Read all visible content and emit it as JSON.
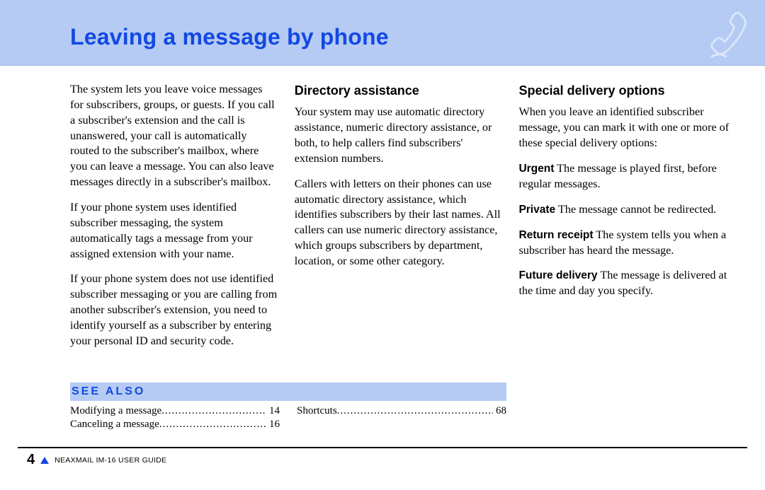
{
  "header": {
    "title": "Leaving a message by phone"
  },
  "col1": {
    "p1": "The system lets you leave voice messages for subscribers, groups, or guests. If you call a subscriber's extension and the call is unanswered, your call is automatically routed to the subscriber's mailbox, where you can leave a message. You can also leave messages directly in a subscriber's mailbox.",
    "p2": "If your phone system uses identified subscriber messaging, the system automatically tags a message from your assigned extension with your name.",
    "p3": "If your phone system does not use identified subscriber messaging or you are calling from another subscriber's extension, you need to identify yourself as a subscriber by entering your personal ID and security code."
  },
  "col2": {
    "heading": "Directory assistance",
    "p1": "Your system may use automatic directory assistance, numeric directory assistance, or both, to help callers find subscribers' extension numbers.",
    "p2": "Callers with letters on their phones can use automatic directory assistance, which identifies subscribers by their last names. All callers can use numeric directory assistance, which groups subscribers by department, location, or some other category."
  },
  "col3": {
    "heading": "Special delivery options",
    "intro": "When you leave an identified subscriber message, you can mark it with one or more of these special delivery options:",
    "opt1_label": "Urgent",
    "opt1_text": "  The message is played first, before regular messages.",
    "opt2_label": "Private",
    "opt2_text": "  The message cannot be redirected.",
    "opt3_label": "Return receipt",
    "opt3_text": "  The system tells you when a subscriber has heard the message.",
    "opt4_label": "Future delivery",
    "opt4_text": "  The message is delivered at the time and day you specify."
  },
  "see_also": {
    "title": "See Also",
    "left": [
      {
        "label": "Modifying a message",
        "page": "14"
      },
      {
        "label": "Canceling a message",
        "page": "16"
      }
    ],
    "right": [
      {
        "label": "Shortcuts",
        "page": "68"
      }
    ]
  },
  "footer": {
    "page_number": "4",
    "guide": "NEAXMAIL IM-16 USER GUIDE"
  }
}
